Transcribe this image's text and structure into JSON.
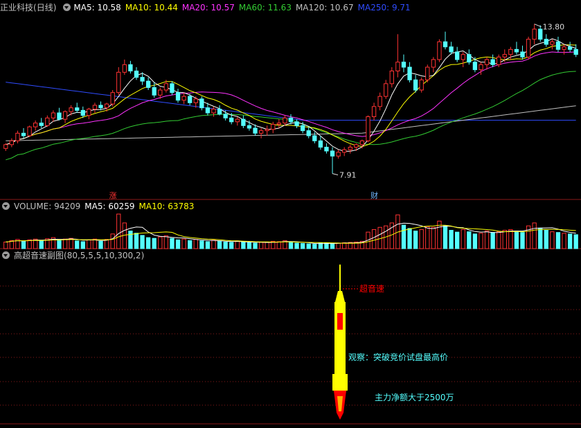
{
  "stock": {
    "name": "正业科技",
    "period": "(日线)"
  },
  "ma_legend": [
    {
      "label": "MA5: 10.58",
      "color": "#ffffff"
    },
    {
      "label": "MA10: 10.44",
      "color": "#ffff00"
    },
    {
      "label": "MA20: 10.57",
      "color": "#ff33ff"
    },
    {
      "label": "MA60: 11.63",
      "color": "#33cc33"
    },
    {
      "label": "MA120: 10.67",
      "color": "#c0c0c0"
    },
    {
      "label": "MA250: 9.71",
      "color": "#2f4cff"
    }
  ],
  "volume_legend": [
    {
      "label": "VOLUME: 94209",
      "color": "#c0c0c0"
    },
    {
      "label": "MA5: 60259",
      "color": "#ffffff"
    },
    {
      "label": "MA10: 63783",
      "color": "#ffff00"
    }
  ],
  "indicator": {
    "title": "高超音速副图",
    "params": "(80,5,5,5,10,300,2)"
  },
  "markers": {
    "zhang": "涨",
    "cai": "财"
  },
  "price_labels": {
    "high": "13.80",
    "low": "7.91"
  },
  "annotations": {
    "supersonic": "超音速",
    "observe": "观察：突破竞价试盘最高价",
    "mainforce": "主力净额大于2500万"
  },
  "colors": {
    "up": "#ff3333",
    "down": "#54ffff",
    "ma5": "#ffffff",
    "ma10": "#ffff00",
    "ma20": "#ff33ff",
    "ma60": "#33cc33",
    "ma120": "#c0c0c0",
    "ma250": "#2f4cff",
    "grid": "#8b1a1a",
    "rocket": "#ffff00",
    "rocket_core": "#ff0000"
  },
  "chart_data": {
    "type": "candlestick",
    "ohlc": [
      [
        8.9,
        9.1,
        8.8,
        9.05
      ],
      [
        9.05,
        9.3,
        8.95,
        9.2
      ],
      [
        9.2,
        9.6,
        9.1,
        9.5
      ],
      [
        9.5,
        9.7,
        9.3,
        9.4
      ],
      [
        9.4,
        9.8,
        9.35,
        9.75
      ],
      [
        9.75,
        10.0,
        9.6,
        9.9
      ],
      [
        9.9,
        10.1,
        9.7,
        9.8
      ],
      [
        9.8,
        10.2,
        9.75,
        10.1
      ],
      [
        10.1,
        10.4,
        9.95,
        10.3
      ],
      [
        10.3,
        10.5,
        10.0,
        10.05
      ],
      [
        10.05,
        10.4,
        9.9,
        10.35
      ],
      [
        10.35,
        10.6,
        10.2,
        10.5
      ],
      [
        10.5,
        10.7,
        10.3,
        10.4
      ],
      [
        10.4,
        10.55,
        10.1,
        10.2
      ],
      [
        10.2,
        10.5,
        10.05,
        10.45
      ],
      [
        10.45,
        10.7,
        10.3,
        10.6
      ],
      [
        10.6,
        10.75,
        10.4,
        10.5
      ],
      [
        10.5,
        10.7,
        10.35,
        10.65
      ],
      [
        10.65,
        11.2,
        10.55,
        11.1
      ],
      [
        11.1,
        12.1,
        11.0,
        11.9
      ],
      [
        11.9,
        12.4,
        11.8,
        12.2
      ],
      [
        12.2,
        12.35,
        11.85,
        11.95
      ],
      [
        11.95,
        12.1,
        11.6,
        11.7
      ],
      [
        11.7,
        11.9,
        11.4,
        11.55
      ],
      [
        11.55,
        11.7,
        11.2,
        11.3
      ],
      [
        11.3,
        11.5,
        10.9,
        11.0
      ],
      [
        11.0,
        11.3,
        10.85,
        11.2
      ],
      [
        11.2,
        11.6,
        11.1,
        11.45
      ],
      [
        11.45,
        11.55,
        11.0,
        11.1
      ],
      [
        11.1,
        11.25,
        10.7,
        10.8
      ],
      [
        10.8,
        11.1,
        10.65,
        10.95
      ],
      [
        10.95,
        11.05,
        10.6,
        10.7
      ],
      [
        10.7,
        10.95,
        10.5,
        10.85
      ],
      [
        10.85,
        10.95,
        10.4,
        10.5
      ],
      [
        10.5,
        10.7,
        10.2,
        10.3
      ],
      [
        10.3,
        10.55,
        10.15,
        10.45
      ],
      [
        10.45,
        10.6,
        10.2,
        10.25
      ],
      [
        10.25,
        10.4,
        10.0,
        10.1
      ],
      [
        10.1,
        10.3,
        9.85,
        9.95
      ],
      [
        9.95,
        10.15,
        9.8,
        10.05
      ],
      [
        10.05,
        10.2,
        9.7,
        9.8
      ],
      [
        9.8,
        10.0,
        9.6,
        9.7
      ],
      [
        9.7,
        9.85,
        9.4,
        9.5
      ],
      [
        9.5,
        9.7,
        9.3,
        9.6
      ],
      [
        9.6,
        9.8,
        9.4,
        9.65
      ],
      [
        9.65,
        9.95,
        9.5,
        9.85
      ],
      [
        9.85,
        10.05,
        9.7,
        9.9
      ],
      [
        9.9,
        10.2,
        9.8,
        10.1
      ],
      [
        10.1,
        10.25,
        9.85,
        9.95
      ],
      [
        9.95,
        10.05,
        9.7,
        9.8
      ],
      [
        9.8,
        9.95,
        9.5,
        9.6
      ],
      [
        9.6,
        9.75,
        9.3,
        9.4
      ],
      [
        9.4,
        9.55,
        9.1,
        9.2
      ],
      [
        9.2,
        9.4,
        8.85,
        8.95
      ],
      [
        8.95,
        9.1,
        8.7,
        8.8
      ],
      [
        8.8,
        8.95,
        7.91,
        8.6
      ],
      [
        8.6,
        8.85,
        8.5,
        8.75
      ],
      [
        8.75,
        8.95,
        8.6,
        8.85
      ],
      [
        8.85,
        9.05,
        8.7,
        8.95
      ],
      [
        8.95,
        9.1,
        8.8,
        9.05
      ],
      [
        9.05,
        9.25,
        8.9,
        9.2
      ],
      [
        9.2,
        10.2,
        9.15,
        10.15
      ],
      [
        10.15,
        10.7,
        10.0,
        10.55
      ],
      [
        10.55,
        11.1,
        10.4,
        10.95
      ],
      [
        10.95,
        11.6,
        10.85,
        11.45
      ],
      [
        11.45,
        12.1,
        11.3,
        11.95
      ],
      [
        11.95,
        13.4,
        11.7,
        12.3
      ],
      [
        12.3,
        12.6,
        11.9,
        12.1
      ],
      [
        12.1,
        12.3,
        11.5,
        11.6
      ],
      [
        11.6,
        11.8,
        11.1,
        11.2
      ],
      [
        11.2,
        11.7,
        11.1,
        11.6
      ],
      [
        11.6,
        12.2,
        11.5,
        12.1
      ],
      [
        12.1,
        12.5,
        11.9,
        12.4
      ],
      [
        12.4,
        13.2,
        12.3,
        13.1
      ],
      [
        13.1,
        13.5,
        12.8,
        12.9
      ],
      [
        12.9,
        13.1,
        12.6,
        12.7
      ],
      [
        12.7,
        12.9,
        12.3,
        12.4
      ],
      [
        12.4,
        12.7,
        12.1,
        12.6
      ],
      [
        12.6,
        12.8,
        12.2,
        12.3
      ],
      [
        12.3,
        12.5,
        11.9,
        12.0
      ],
      [
        12.0,
        12.3,
        11.8,
        12.2
      ],
      [
        12.2,
        12.5,
        12.0,
        12.4
      ],
      [
        12.4,
        12.6,
        12.1,
        12.2
      ],
      [
        12.2,
        12.6,
        12.1,
        12.5
      ],
      [
        12.5,
        12.8,
        12.3,
        12.6
      ],
      [
        12.6,
        12.9,
        12.4,
        12.8
      ],
      [
        12.8,
        13.1,
        12.6,
        12.7
      ],
      [
        12.7,
        12.95,
        12.4,
        12.5
      ],
      [
        12.5,
        13.3,
        12.4,
        13.2
      ],
      [
        13.2,
        13.8,
        13.0,
        13.6
      ],
      [
        13.6,
        13.75,
        13.1,
        13.2
      ],
      [
        13.2,
        13.4,
        12.9,
        13.0
      ],
      [
        13.0,
        13.2,
        12.8,
        13.1
      ],
      [
        13.1,
        13.3,
        12.7,
        12.8
      ],
      [
        12.8,
        13.0,
        12.6,
        12.9
      ],
      [
        12.9,
        13.1,
        12.7,
        12.8
      ],
      [
        12.8,
        13.0,
        12.5,
        12.6
      ]
    ],
    "volume": [
      18000,
      22000,
      25000,
      20000,
      24000,
      26000,
      21000,
      27000,
      30000,
      22000,
      26000,
      28000,
      21000,
      19000,
      24000,
      26000,
      20000,
      25000,
      40000,
      94209,
      70000,
      48000,
      42000,
      36000,
      30000,
      28000,
      32000,
      35000,
      28000,
      24000,
      26000,
      22000,
      25000,
      21000,
      19000,
      23000,
      20000,
      18000,
      17000,
      21000,
      18000,
      16000,
      15000,
      17000,
      18000,
      20000,
      19000,
      22000,
      17000,
      15000,
      14000,
      13000,
      12000,
      15000,
      16000,
      14000,
      15000,
      16000,
      17000,
      18000,
      20000,
      45000,
      52000,
      58000,
      62000,
      70000,
      92000,
      64000,
      55000,
      48000,
      52000,
      60000,
      58000,
      75000,
      62000,
      50000,
      45000,
      52000,
      46000,
      40000,
      42000,
      48000,
      44000,
      46000,
      50000,
      52000,
      48000,
      44000,
      62000,
      70000,
      56000,
      50000,
      46000,
      44000,
      42000,
      40000,
      38000
    ],
    "price_range": [
      7.6,
      14.2
    ],
    "volume_range": [
      0,
      100000
    ],
    "high_label": "13.80",
    "low_label": "7.91"
  }
}
